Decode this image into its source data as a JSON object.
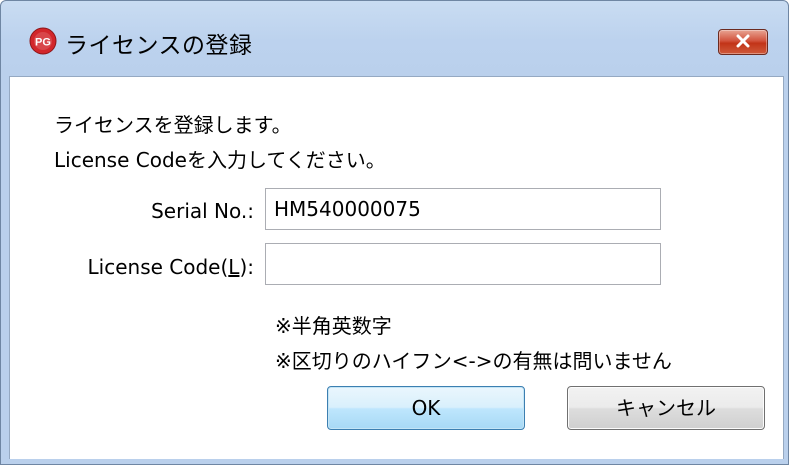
{
  "window": {
    "title": "ライセンスの登録",
    "icon": "pg-app-icon",
    "close_icon": "close-icon"
  },
  "message": {
    "line1": "ライセンスを登録します。",
    "line2": "License Codeを入力してください。"
  },
  "form": {
    "serial_label": "Serial No.:",
    "serial_value": "HM540000075",
    "license_label_prefix": "License Code(",
    "license_label_accel": "L",
    "license_label_suffix": "):",
    "license_value": ""
  },
  "notes": {
    "line1": "※半角英数字",
    "line2": "※区切りのハイフン<->の有無は問いません"
  },
  "buttons": {
    "ok_label": "OK",
    "cancel_label": "キャンセル"
  },
  "colors": {
    "titlebar": "#bcd2ee",
    "close_button": "#c23418",
    "ok_border": "#3c7fb1"
  }
}
